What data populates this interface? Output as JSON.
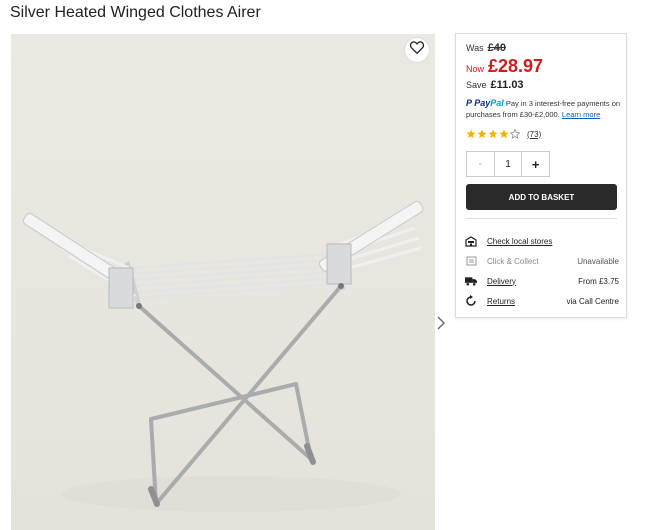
{
  "product": {
    "title": "Silver Heated Winged Clothes Airer"
  },
  "pricing": {
    "was_label": "Was",
    "was_value": "£40",
    "now_label": "Now",
    "now_value": "£28.97",
    "save_label": "Save",
    "save_value": "£11.03"
  },
  "paypal": {
    "logo_pay": "Pay",
    "logo_pal": "Pal",
    "text": "Pay in 3 interest-free payments on purchases from £30-£2,000.",
    "learn_more": "Learn more"
  },
  "rating": {
    "stars": 4,
    "max": 5,
    "reviews": "(73)"
  },
  "quantity": {
    "minus": "-",
    "value": "1",
    "plus": "+"
  },
  "basket": {
    "add_label": "ADD TO BASKET"
  },
  "fulfilment": [
    {
      "label": "Check local stores",
      "value": "",
      "icon": "store-icon",
      "linked": true
    },
    {
      "label": "Click & Collect",
      "value": "Unavailable",
      "icon": "click-collect-icon",
      "linked": false
    },
    {
      "label": "Delivery",
      "value": "From £3.75",
      "icon": "truck-icon",
      "linked": true
    },
    {
      "label": "Returns",
      "value": "via Call Centre",
      "icon": "returns-icon",
      "linked": true
    }
  ],
  "colors": {
    "price_red": "#d11a1a",
    "button_dark": "#2a2a2a",
    "star_gold": "#f5b301",
    "paypal_blue": "#003087"
  }
}
